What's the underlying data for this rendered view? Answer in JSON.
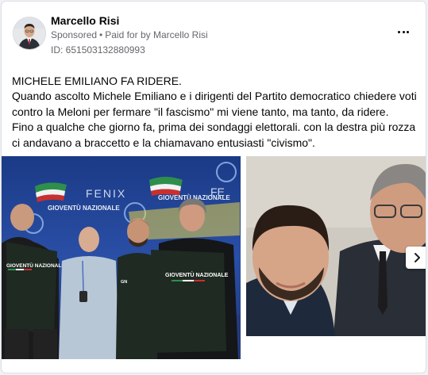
{
  "post": {
    "author": "Marcello Risi",
    "sponsored": "Sponsored",
    "separator": "•",
    "paid_for_by": "Paid for by",
    "payer": "Marcello Risi",
    "ad_id": "ID: 651503132880993",
    "body_lines": [
      "MICHELE EMILIANO FA RIDERE.",
      "Quando ascolto Michele Emiliano e i dirigenti del Partito democratico chiedere voti",
      "contro la Meloni per fermare \"il fascismo\" mi viene tanto, ma tanto, da ridere.",
      "Fino a qualche che giorno fa, prima dei sondaggi elettorali. con la destra più rozza",
      "ci andavano a braccetto e la chiamavano entusiasti \"civismo\"."
    ]
  },
  "photo1": {
    "banner_left": "GIOVENTÙ NAZIONALE",
    "banner_fenix": "FENIX",
    "banner_right": "GIOVENTÙ NAZIONALE",
    "banner_far": "FE",
    "shirt_left": "GIOVENTÙ NAZIONALE",
    "shirt_right": "GIOVENTÙ NAZIONALE"
  },
  "colors": {
    "stage_blue": "#1d3f8a",
    "shirt_green": "#1f2a22",
    "text_primary": "#050505",
    "text_secondary": "#65676b"
  },
  "icons": {
    "more": "more-horizontal-icon",
    "next": "chevron-right-icon"
  }
}
